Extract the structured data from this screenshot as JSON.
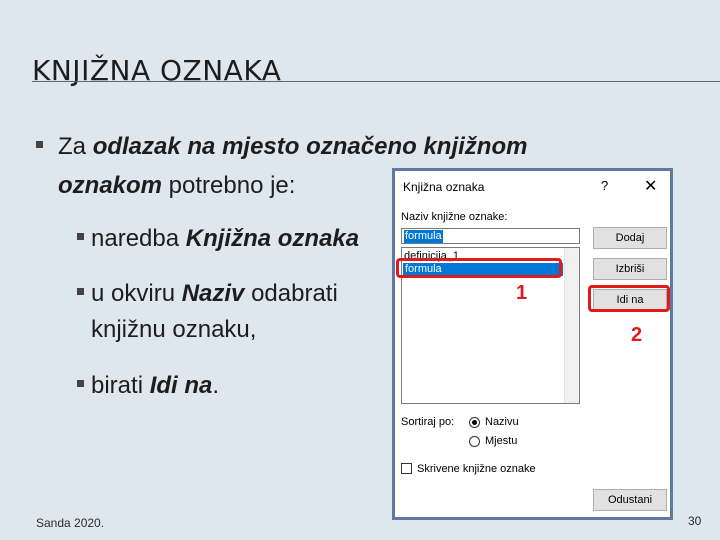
{
  "slide": {
    "title": "KNJIŽNA OZNAKA",
    "bullet1_pre": "Za ",
    "bullet1_em1": "odlazak na mjesto označeno knjižnom",
    "bullet1_em2": "oznakom",
    "bullet1_post": " potrebno je:",
    "sub1_pre": "naredba ",
    "sub1_em": "Knjižna oznaka",
    "sub2_pre": "u okviru ",
    "sub2_em": "Naziv",
    "sub2_post": " odabrati",
    "sub2_line2": "knjižnu oznaku,",
    "sub3_pre": "birati ",
    "sub3_em": "Idi na",
    "sub3_post": ".",
    "footer_left": "Sanda 2020.",
    "footer_right": "30"
  },
  "dialog": {
    "title": "Knjižna oznaka",
    "help": "?",
    "close": "✕",
    "name_label": "Naziv knjižne oznake:",
    "name_value": "formula",
    "list_items": [
      "definicija_1",
      "formula"
    ],
    "buttons": {
      "add": "Dodaj",
      "delete": "Izbriši",
      "goto": "Idi na",
      "cancel": "Odustani"
    },
    "sort_label": "Sortiraj po:",
    "sort_options": [
      "Nazivu",
      "Mjestu"
    ],
    "hidden_label": "Skrivene knjižne oznake"
  },
  "annotations": {
    "one": "1",
    "two": "2",
    "color": "#e01b1b"
  }
}
